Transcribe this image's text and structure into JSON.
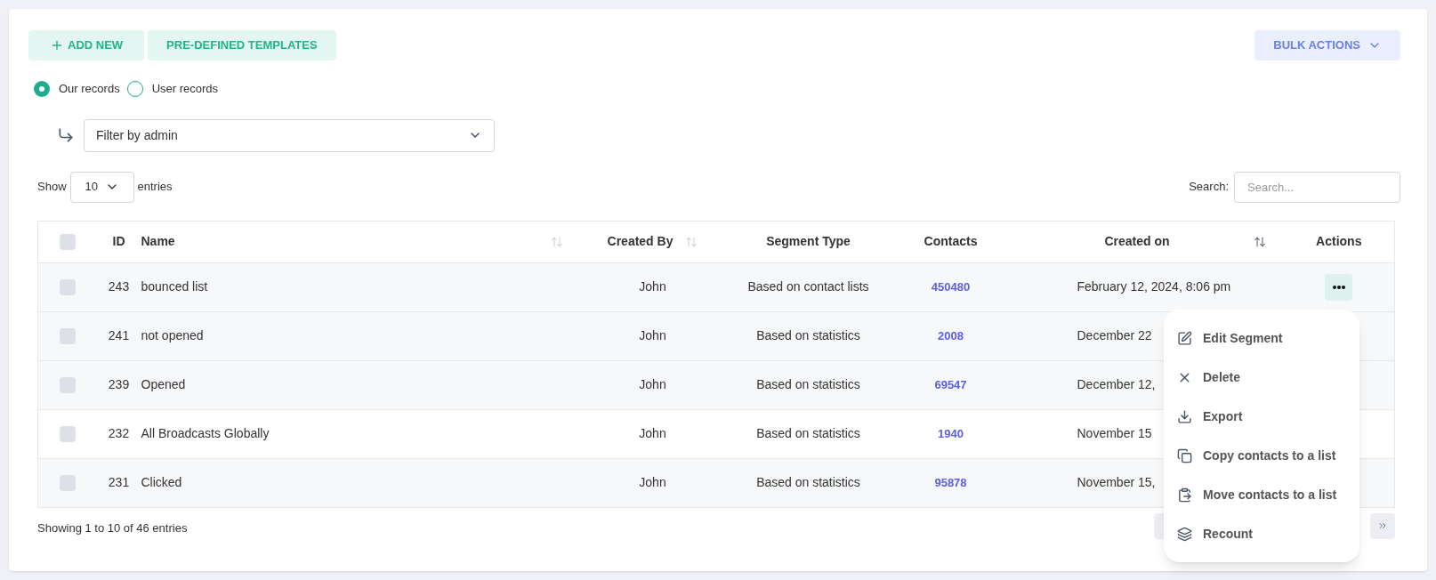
{
  "toolbar": {
    "add_button": "ADD NEW",
    "templates_button": "PRE-DEFINED TEMPLATES",
    "bulk_button": "BULK ACTIONS"
  },
  "record_options": [
    {
      "label": "Our records",
      "selected": true
    },
    {
      "label": "User records",
      "selected": false
    }
  ],
  "admin_filter": {
    "value": "Filter by admin"
  },
  "length": {
    "before": "Show",
    "value": "10",
    "after": "entries"
  },
  "search": {
    "label": "Search:",
    "placeholder": "Search..."
  },
  "table": {
    "select_all": {
      "checked": false
    },
    "columns": [
      "ID",
      "Name",
      "Created By",
      "Segment Type",
      "Contacts",
      "Created on",
      "Actions"
    ],
    "rows": [
      {
        "checked": false,
        "id": "243",
        "name": "bounced list",
        "created_by": "John",
        "segment_type": "Based on contact lists",
        "contacts": "450480",
        "created_on": "February 12, 2024, 8:06 pm"
      },
      {
        "checked": false,
        "id": "241",
        "name": "not opened",
        "created_by": "John",
        "segment_type": "Based on statistics",
        "contacts": "2008",
        "created_on": "December 22"
      },
      {
        "checked": false,
        "id": "239",
        "name": "Opened",
        "created_by": "John",
        "segment_type": "Based on statistics",
        "contacts": "69547",
        "created_on": "December 12,"
      },
      {
        "checked": false,
        "id": "232",
        "name": "All Broadcasts Globally",
        "created_by": "John",
        "segment_type": "Based on statistics",
        "contacts": "1940",
        "created_on": "November 15"
      },
      {
        "checked": false,
        "id": "231",
        "name": "Clicked",
        "created_by": "John",
        "segment_type": "Based on statistics",
        "contacts": "95878",
        "created_on": "November 15,"
      }
    ]
  },
  "info": "Showing 1 to 10 of 46 entries",
  "actions_menu": [
    {
      "kind": "edit",
      "label": "Edit Segment"
    },
    {
      "kind": "delete",
      "label": "Delete"
    },
    {
      "kind": "export",
      "label": "Export"
    },
    {
      "kind": "copy",
      "label": "Copy contacts to a list"
    },
    {
      "kind": "move",
      "label": "Move contacts to a list"
    },
    {
      "kind": "recount",
      "label": "Recount"
    }
  ]
}
